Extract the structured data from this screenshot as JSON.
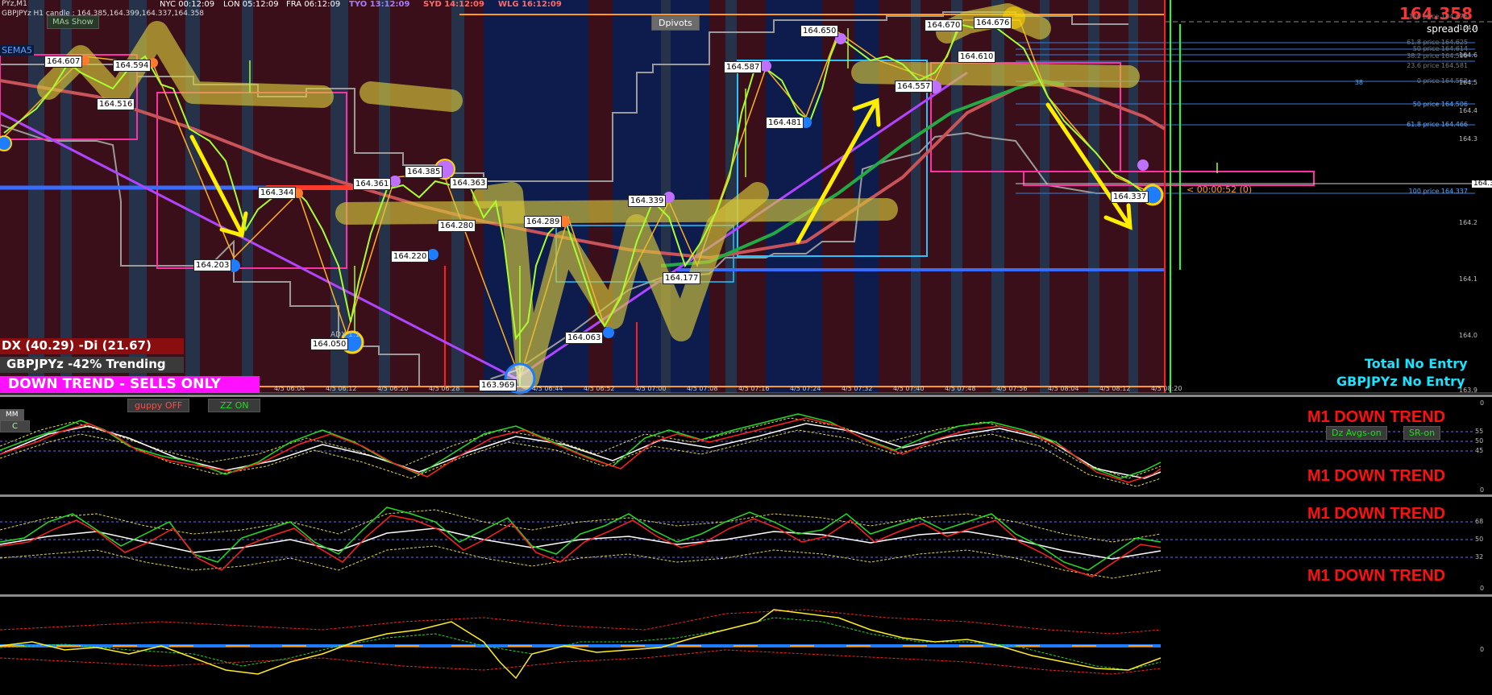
{
  "window": {
    "title": "PYz,M1",
    "info": "GBPJPYz H1 candle : 164.385,164.399,164.337,164.358"
  },
  "sessions": [
    {
      "label": "NYC 00:12:09",
      "color": "#d0d0d0"
    },
    {
      "label": "LON 05:12:09",
      "color": "#d0d0d0"
    },
    {
      "label": "FRA 06:12:09",
      "color": "#d0d0d0"
    },
    {
      "label": "TYO 13:12:09",
      "color": "#a87cff"
    },
    {
      "label": "SYD 14:12:09",
      "color": "#ff6a6a"
    },
    {
      "label": "WLG 16:12:09",
      "color": "#ff6a6a"
    }
  ],
  "top_right": {
    "bid": "164.358",
    "spread": "spread 0.0",
    "countdown": "< 00:00:52 (0)"
  },
  "buttons": {
    "dpivots": "Dpivots",
    "ma_show": "MAs Show",
    "guppy": "guppy OFF",
    "zz": "ZZ ON",
    "dz_avgs": "Dz Avgs-on",
    "sr": "SR-on",
    "mm": "MM",
    "c": "C"
  },
  "ema_label": "SEMA5",
  "adx": {
    "line": "DX (40.29)  -Di (21.67)",
    "trend": "GBPJPYz -42% Trending",
    "signal": "DOWN TREND - SELLS ONLY"
  },
  "entry": {
    "total": "Total No Entry",
    "pair": "GBPJPYz No Entry"
  },
  "fib_levels": [
    "100 price 164.676",
    "61.8 price 164.625",
    "50 price 164.614",
    "38.2 price 164.599",
    "23.6 price 164.581",
    "0 price 164.552",
    "38",
    "50 price 164.506",
    "61.8 price 164.466",
    "100 price 164.337"
  ],
  "price_axis": [
    "164.7",
    "164.6",
    "164.5",
    "164.4",
    "164.3",
    "164.2",
    "164.1",
    "164.0",
    "163.9"
  ],
  "time_axis": [
    "4/5 06:04",
    "4/5 06:12",
    "4/5 06:20",
    "4/5 06:28",
    "4/5 06:44",
    "4/5 06:52",
    "4/5 07:00",
    "4/5 07:08",
    "4/5 07:16",
    "4/5 07:24",
    "4/5 07:32",
    "4/5 07:40",
    "4/5 07:48",
    "4/5 07:56",
    "4/5 08:04",
    "4/5 08:12",
    "4/5 08:20"
  ],
  "price_labels": [
    "164.607",
    "164.594",
    "164.516",
    "164.344",
    "164.203",
    "164.050",
    "164.361",
    "164.385",
    "164.363",
    "164.280",
    "164.220",
    "163.969",
    "164.289",
    "164.063",
    "164.339",
    "164.177",
    "164.587",
    "164.481",
    "164.650",
    "164.670",
    "164.676",
    "164.610",
    "164.557",
    "164.337"
  ],
  "adx_text_small": "ADX 1.1",
  "osc1": {
    "label1": "M1 DOWN TREND",
    "label2": "M1 DOWN TREND",
    "levels": [
      "0",
      "55",
      "50",
      "45",
      "0"
    ]
  },
  "osc2": {
    "label1": "M1 DOWN TREND",
    "label2": "M1 DOWN TREND",
    "levels": [
      "68",
      "50",
      "32",
      "0"
    ]
  },
  "osc3": {
    "levels": [
      "0"
    ]
  }
}
